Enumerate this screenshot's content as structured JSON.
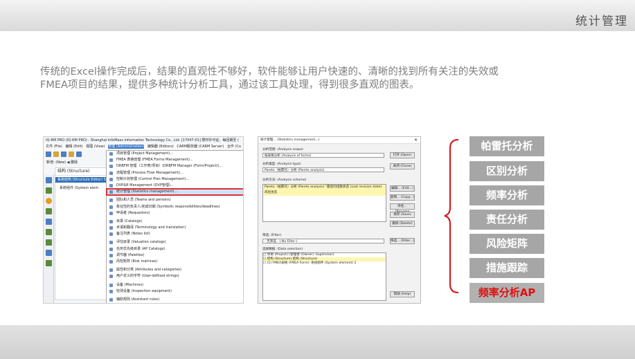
{
  "header": {
    "title": "统计管理"
  },
  "intro": {
    "line1": "传统的Excel操作完成后，结果的直观性不够好，软件能够让用户快速的、清晰的找到所有关注的失效或",
    "line2": "FMEA项目的结果，提供多种统计分析工具，通过该工具处理，得到很多直观的图表。"
  },
  "app_window": {
    "title": "IQ-RM PRO (IQ-RM PRO) - Shanghai InfoMass Information Technology Co., Ltd. [17047-01] 限时许可证。每回期至 (",
    "menu": [
      "文件 (File)",
      "编辑 (Edit)",
      "视图 (View)",
      "管理 (Administration)",
      "编辑器 (Editors)",
      "CARM服务器 (CARM Server)",
      "合作 (Co"
    ],
    "nav_label": "新增: (New) ◀ 删除",
    "tree_root": "结构 (Structure)",
    "tree_selected": "系统结构 (Structure Editor) 5",
    "tree_item": "系统组件 (System elem",
    "admin_menu": [
      "项目管理 (Project Management)...",
      "FMEA 表格管理 (FMEA Forms Management)...",
      "DRBFM 管理（工作表/项目）(DRBFM Manager (Form/Project))...",
      "流程管理 (Process Flow Management)...",
      "控制计划管理 (Control Plan Management)...",
      "DVP&R Management (DVP管理)...",
      "统计管理 (Statistics management)...",
      "团队和人员 (Teams and persons)",
      "象征性的负责人/完成日期 (Symbolic responsibilities/deadlines)",
      "申请者 (Requestors)",
      "目录 (Catalogs)",
      "术语和翻译 (Terminology and translation)",
      "备注列表 (Notes list)",
      "评估目录 (Valuation catalogs)",
      "任务优先级目录 (AP Catalogs)",
      "调节器 (Palettes)",
      "风险矩阵 (Risk matrices)",
      "属性和分类 (Attributes and categories)",
      "用户定义的字符 (User-defined strings)",
      "设备 (Machines)",
      "检测设备 (Inspection equipment)",
      "辅助规则 (Assistant rules)"
    ],
    "selected_menu_index": 6
  },
  "stats_dialog": {
    "title": "统计管理... (Statistics management...)",
    "scope_label": "分析范围: (Analysis scope)",
    "scope_value": "按表格分析 (Analysis of forms)",
    "type_label": "分析类型: (Analysis type)",
    "type_value": "Pareto（帕累托）分析 (Pareto analysis)",
    "scheme_label": "分析方法: (Analysis scheme)",
    "scheme_item": "Pareto（帕累托）分析 (Pareto analysis) \"最后的措施状态 (Last revision state) 风险优先",
    "filter_label": "筛选: (Filter)",
    "filter_value": "- 无筛选 - (-No Filter-)",
    "selection_label": "选择数据: (Data selection)",
    "tree": [
      "□ 项目 (Project) [管理者 (Owner): Supervisor]",
      "  ☐ 结构 (Structure) 结构 (Structure)",
      "      ☐ (1) FMEA表格 (FMEA Form): 系统组件 (System element) 2"
    ],
    "buttons": {
      "open": "打开 (Open)",
      "close": "关闭 (Close)",
      "edit": "编辑... (Edit...)",
      "copy": "复制... (Copy...)",
      "rename": "改名... (Rename",
      "save": "保存 (Save)",
      "delete": "删除 (Delete)",
      "filter": "筛选... (Filter...)",
      "help": "帮助 (Help)"
    }
  },
  "features": [
    {
      "label": "帕雷托分析"
    },
    {
      "label": "区别分析"
    },
    {
      "label": "频率分析"
    },
    {
      "label": "责任分析"
    },
    {
      "label": "风险矩阵"
    },
    {
      "label": "措施跟踪"
    },
    {
      "label": "频率分析AP"
    }
  ],
  "colors": {
    "bracket": "#d32020",
    "feature_bg": "#a6a6a6",
    "feature_red_text": "#e01010",
    "highlight_border": "#e03030"
  }
}
